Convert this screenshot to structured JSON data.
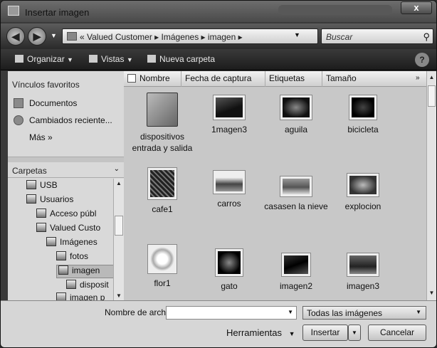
{
  "window": {
    "title": "Insertar imagen",
    "close_glyph": "x"
  },
  "address": {
    "back_glyph": "◀",
    "forward_glyph": "▶",
    "crumbs": "« Valued Customer  ▸  Imágenes  ▸  imagen  ▸",
    "refresh_glyph": "⁴⁄",
    "search_placeholder": "Buscar"
  },
  "toolbar": {
    "organize": "Organizar",
    "views": "Vistas",
    "new_folder": "Nueva carpeta",
    "help": "?"
  },
  "favorites": {
    "heading": "Vínculos favoritos",
    "items": [
      "Documentos",
      "Cambiados reciente..."
    ],
    "more": "Más  »"
  },
  "folders": {
    "heading": "Carpetas",
    "tree": [
      "USB",
      "Usuarios",
      "Acceso públ",
      "Valued Custo",
      "Imágenes",
      "fotos",
      "imagen",
      "disposit",
      "imagen p"
    ]
  },
  "columns": [
    "Nombre",
    "Fecha de captura",
    "Etiquetas",
    "Tamaño"
  ],
  "files": [
    {
      "name": "dispositivos entrada y salida",
      "kind": "folder"
    },
    {
      "name": "1magen3",
      "kind": "image"
    },
    {
      "name": "aguila",
      "kind": "image"
    },
    {
      "name": "bicicleta",
      "kind": "image"
    },
    {
      "name": "cafe1",
      "kind": "image"
    },
    {
      "name": "carros",
      "kind": "image"
    },
    {
      "name": "casasen la nieve",
      "kind": "image"
    },
    {
      "name": "explocion",
      "kind": "image"
    },
    {
      "name": "flor1",
      "kind": "image"
    },
    {
      "name": "gato",
      "kind": "image"
    },
    {
      "name": "imagen2",
      "kind": "image"
    },
    {
      "name": "imagen3",
      "kind": "image"
    }
  ],
  "footer": {
    "filename_label": "Nombre de archivo:",
    "filename_value": "",
    "filter": "Todas las imágenes",
    "tools": "Herramientas",
    "insert": "Insertar",
    "cancel": "Cancelar"
  }
}
